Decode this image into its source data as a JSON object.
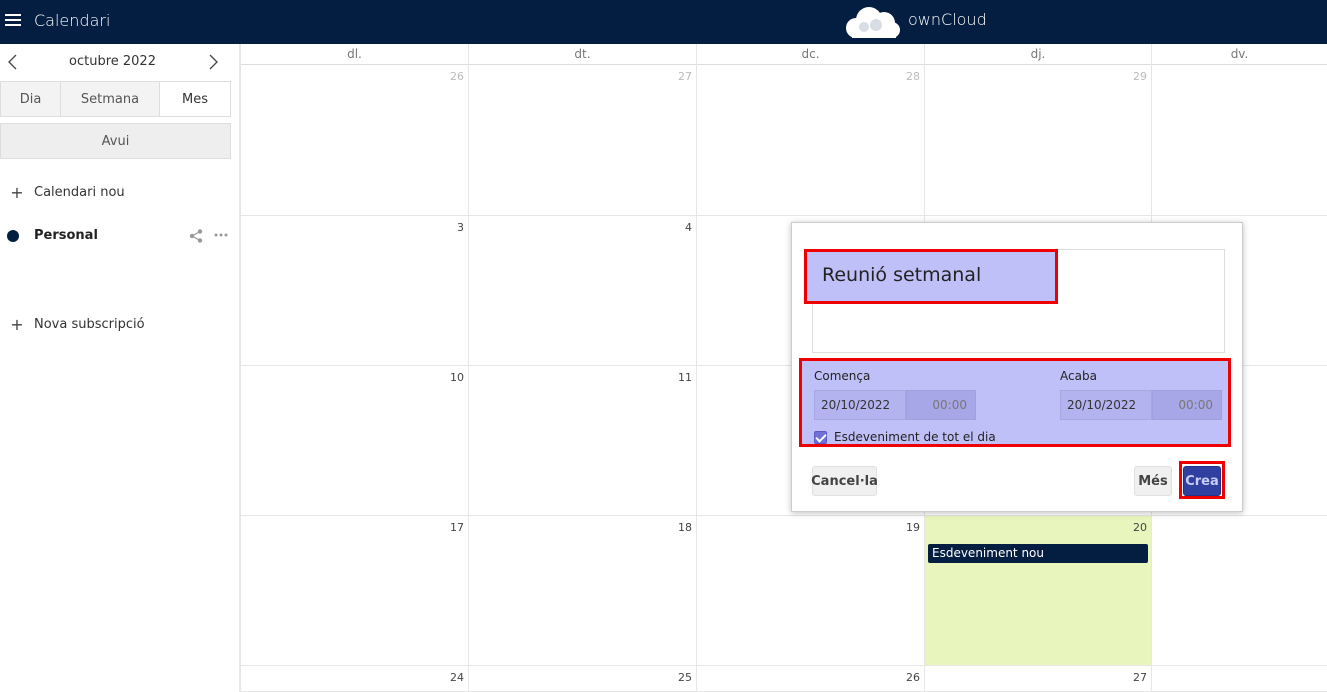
{
  "header": {
    "app_name": "Calendari",
    "brand": "ownCloud",
    "bg_color": "#041e42"
  },
  "sidebar": {
    "month_label": "octubre 2022",
    "tabs": [
      {
        "label": "Dia"
      },
      {
        "label": "Setmana"
      },
      {
        "label": "Mes"
      }
    ],
    "today_label": "Avui",
    "new_calendar_label": "Calendari nou",
    "calendars": [
      {
        "name": "Personal",
        "color": "#041e42"
      }
    ],
    "new_subscription_label": "Nova subscripció"
  },
  "calendar": {
    "weekdays": [
      "dl.",
      "dt.",
      "dc.",
      "dj.",
      "dv."
    ],
    "weeks": [
      [
        "26",
        "27",
        "28",
        "29",
        ""
      ],
      [
        "3",
        "4",
        "",
        "",
        ""
      ],
      [
        "10",
        "11",
        "",
        "",
        ""
      ],
      [
        "17",
        "18",
        "19",
        "20",
        ""
      ],
      [
        "24",
        "25",
        "26",
        "27",
        ""
      ]
    ],
    "today_color": "#e8f6bd",
    "event": {
      "title": "Esdeveniment nou"
    }
  },
  "popover": {
    "title_value": "Reunió setmanal",
    "start_label": "Comença",
    "start_date": "20/10/2022",
    "start_time": "00:00",
    "end_label": "Acaba",
    "end_date": "20/10/2022",
    "end_time": "00:00",
    "allday_label": "Esdeveniment de tot el dia",
    "cancel_label": "Cancel·la",
    "more_label": "Més",
    "create_label": "Crea",
    "highlight_color": "#c0c0f8",
    "outline_color": "#ee0000"
  }
}
